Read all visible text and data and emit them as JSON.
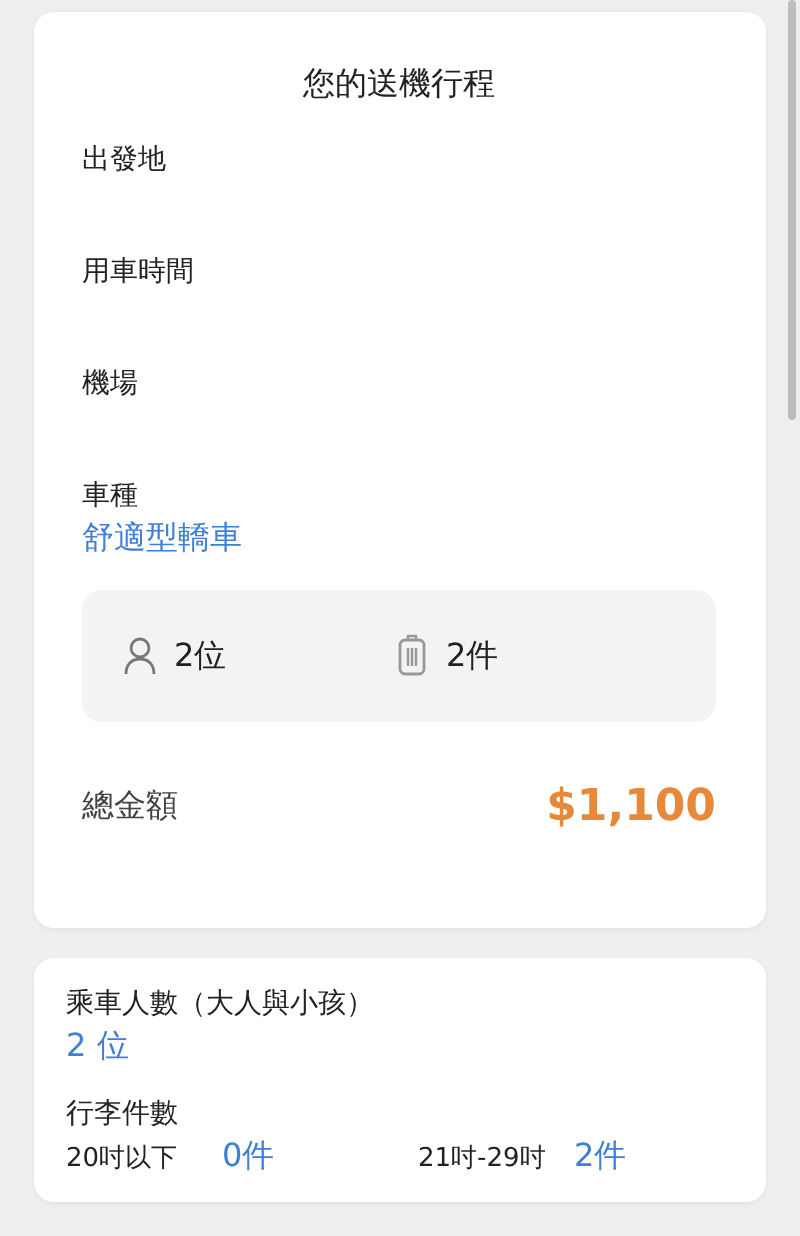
{
  "trip": {
    "title": "您的送機行程",
    "fields": [
      {
        "label": "出發地"
      },
      {
        "label": "用車時間"
      },
      {
        "label": "機場"
      },
      {
        "label": "車種",
        "value": "舒適型轎車"
      }
    ],
    "summary": [
      {
        "kind": "person",
        "text": "2位"
      },
      {
        "kind": "luggage",
        "text": "2件"
      }
    ],
    "total": {
      "label": "總金額",
      "amount": "$1,100"
    }
  },
  "details": {
    "passengers": {
      "label": "乘車人數（大人與小孩）",
      "value": "2 位"
    },
    "luggage": {
      "label": "行李件數",
      "items": [
        {
          "size": "20吋以下",
          "count": "0件"
        },
        {
          "size": "21吋-29吋",
          "count": "2件"
        }
      ]
    }
  }
}
